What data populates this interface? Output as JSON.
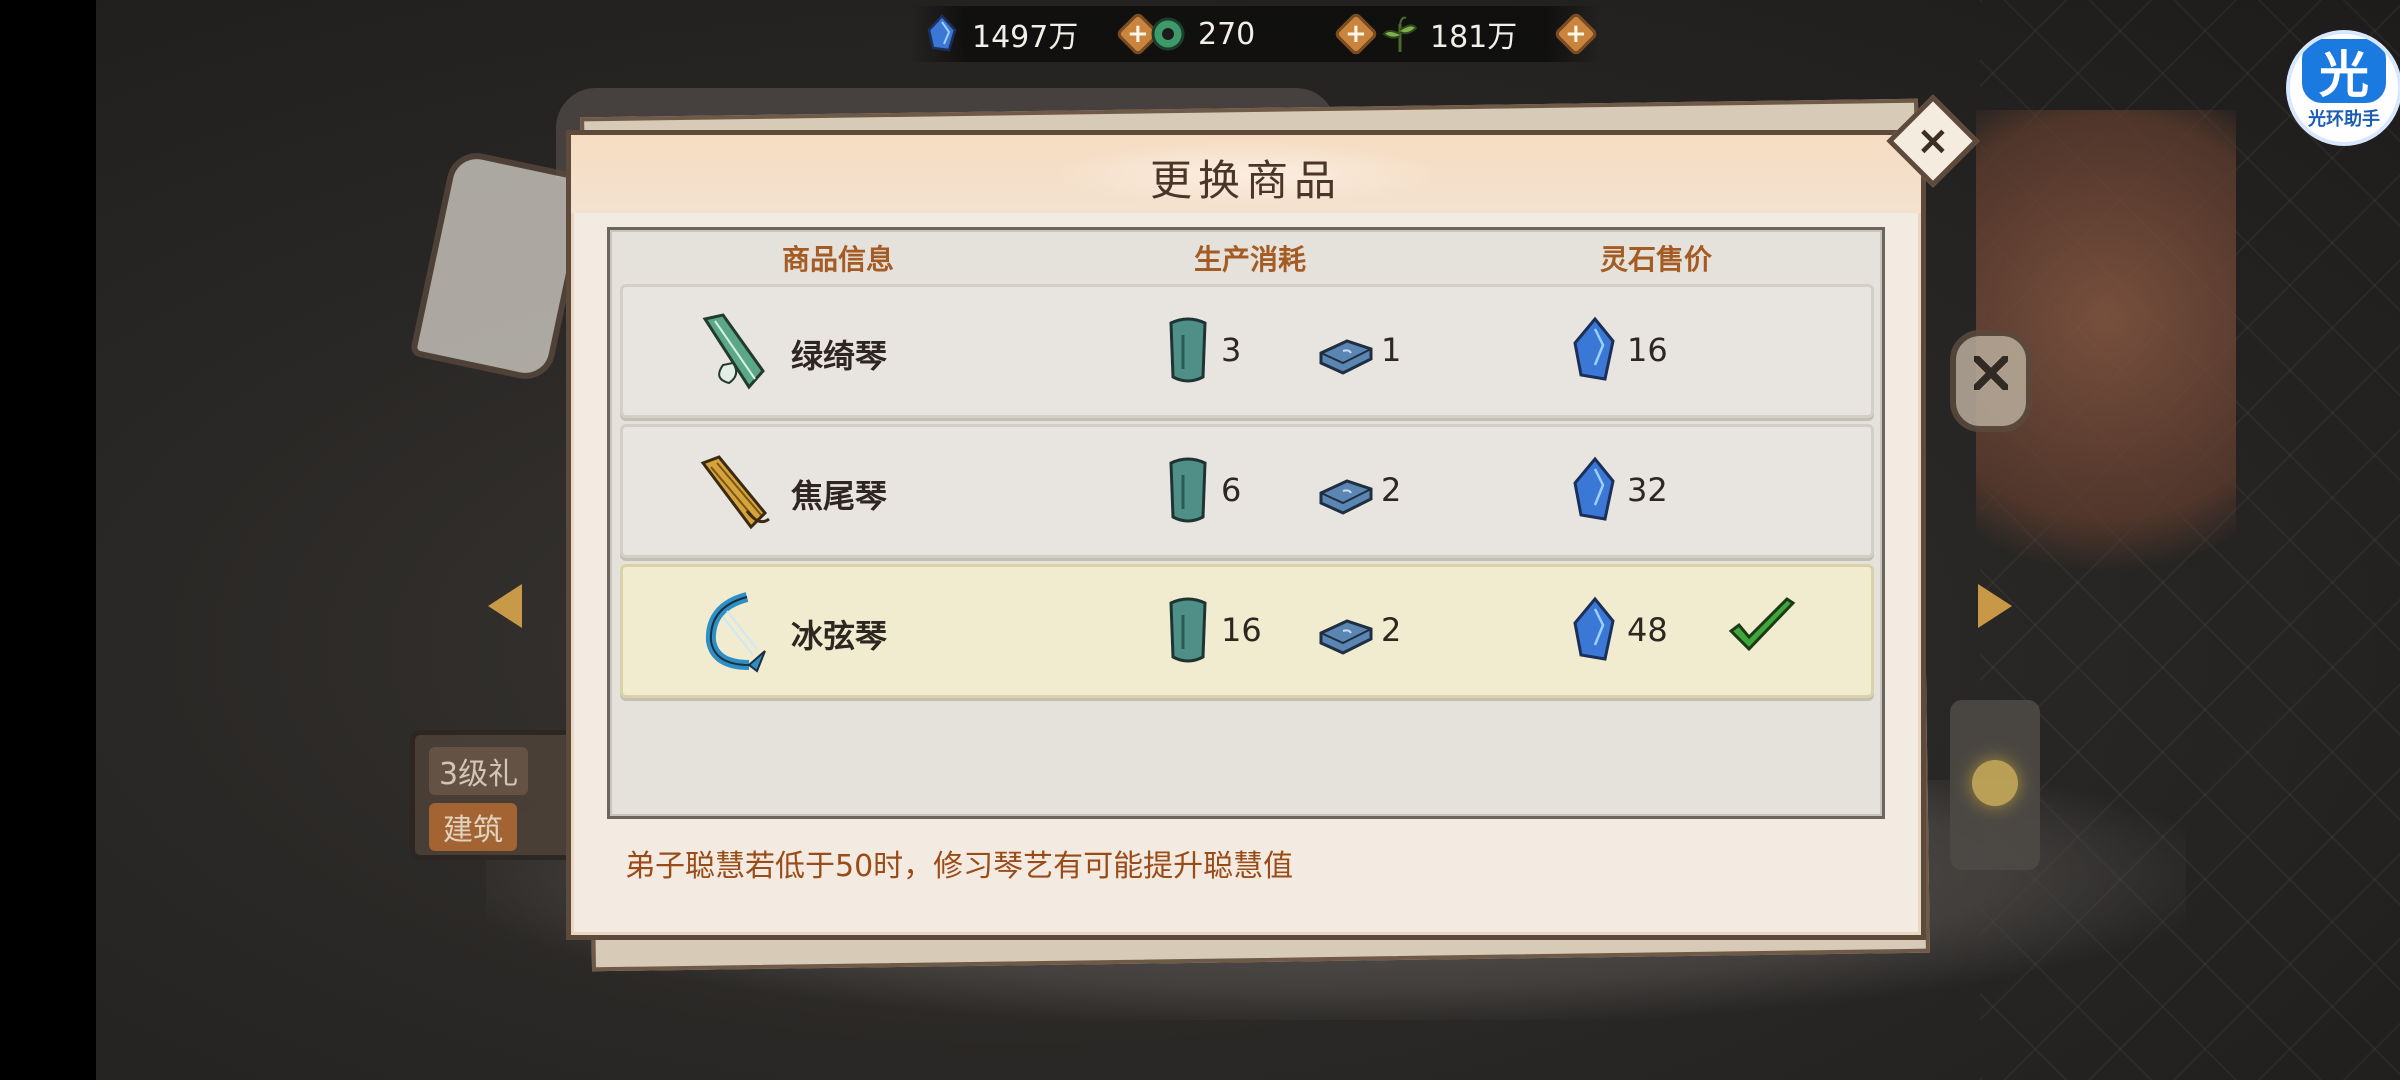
{
  "resources": [
    {
      "icon": "spirit-stone-icon",
      "value": "1497万"
    },
    {
      "icon": "jade-ring-icon",
      "value": "270"
    },
    {
      "icon": "herb-icon",
      "value": "181万"
    }
  ],
  "helper": {
    "big": "光",
    "small": "光环助手"
  },
  "background": {
    "sign_title": "3级礼",
    "sign_button": "建筑"
  },
  "dialog": {
    "title": "更换商品",
    "columns": {
      "info": "商品信息",
      "cost": "生产消耗",
      "price": "灵石售价"
    },
    "items": [
      {
        "name": "绿绮琴",
        "wood": "3",
        "iron": "1",
        "price": "16",
        "selected": false
      },
      {
        "name": "焦尾琴",
        "wood": "6",
        "iron": "2",
        "price": "32",
        "selected": false
      },
      {
        "name": "冰弦琴",
        "wood": "16",
        "iron": "2",
        "price": "48",
        "selected": true
      }
    ],
    "hint": "弟子聪慧若低于50时，修习琴艺有可能提升聪慧值",
    "close_label": "×"
  },
  "colors": {
    "accent_orange": "#a55c24",
    "hint_text": "#9a4c18",
    "selected_row": "#f1ecd0",
    "check_green": "#3fa63a"
  }
}
